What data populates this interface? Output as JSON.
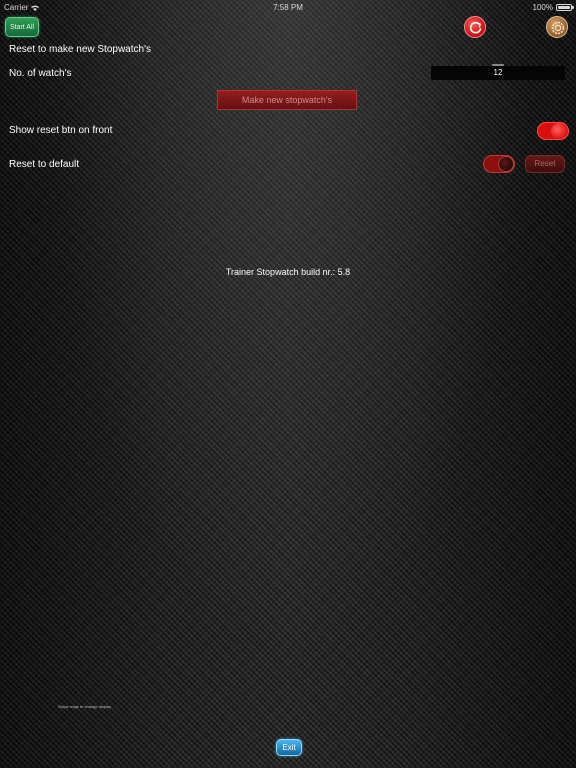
{
  "status_bar": {
    "carrier": "Carrier",
    "time": "7:58 PM",
    "battery": "100%"
  },
  "toolbar": {
    "start_all_label": "Start All",
    "reset_icon": "reset-icon",
    "settings_icon": "gear-icon"
  },
  "settings": {
    "reset_section_label": "Reset to make new Stopwatch's",
    "watch_count_label": "No. of watch's",
    "watch_count_value": "12",
    "make_button_label": "Make new stopwatch's",
    "show_reset_label": "Show reset btn on front",
    "show_reset_enabled": true,
    "reset_default_label": "Reset to default",
    "reset_default_enabled": true,
    "reset_button_label": "Reset"
  },
  "build_info": "Trainer Stopwatch build nr.: 5.8",
  "swipe_hint": "Swipe edge to change display",
  "exit_label": "Exit",
  "colors": {
    "accent_red": "#d90f0f",
    "start_green": "#2f9d55",
    "exit_blue": "#2f8fd0"
  }
}
